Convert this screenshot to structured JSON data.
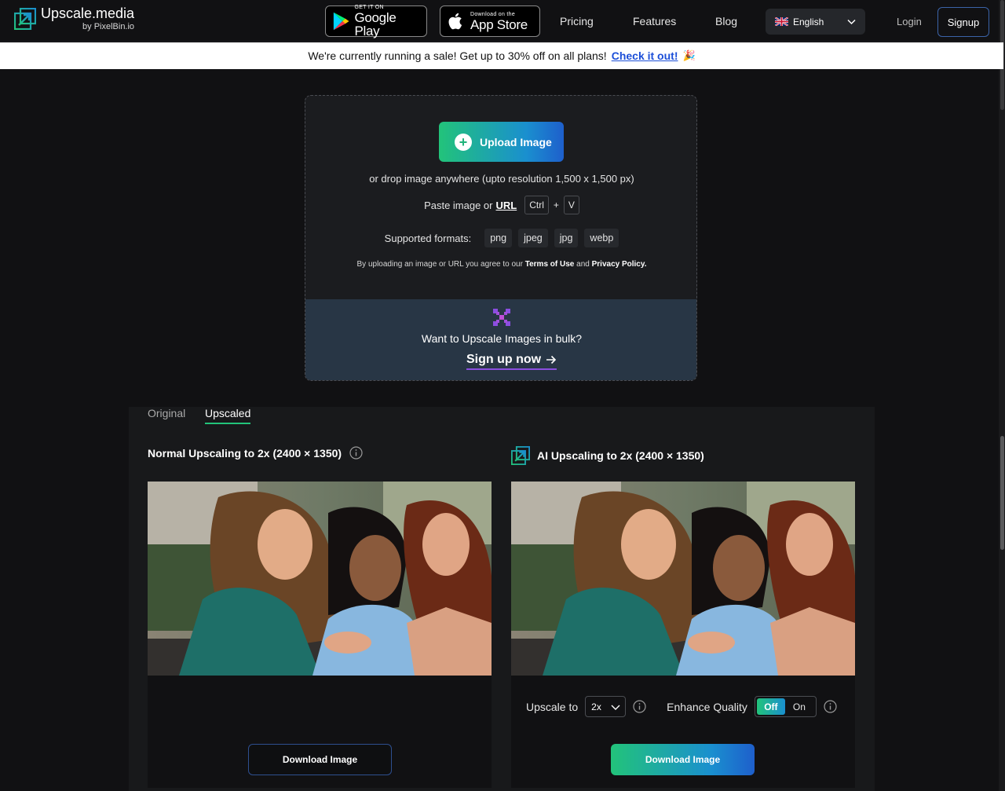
{
  "header": {
    "logo_name": "Upscale.media",
    "logo_by": "by PixelBin.io",
    "google_play": {
      "small": "GET IT ON",
      "big": "Google Play"
    },
    "app_store": {
      "small": "Download on the",
      "big": "App Store"
    },
    "nav": {
      "pricing": "Pricing",
      "features": "Features",
      "blog": "Blog"
    },
    "language": "English",
    "login": "Login",
    "signup": "Signup"
  },
  "banner": {
    "text": "We're currently running a sale! Get up to 30% off on all plans!",
    "link": "Check it out!",
    "emoji": "🎉"
  },
  "upload": {
    "button": "Upload Image",
    "drop_text": "or drop image anywhere (upto resolution 1,500 x 1,500 px)",
    "paste_label": "Paste image or",
    "url_label": "URL",
    "key_ctrl": "Ctrl",
    "key_plus": "+",
    "key_v": "V",
    "formats_label": "Supported formats:",
    "formats": [
      "png",
      "jpeg",
      "jpg",
      "webp"
    ],
    "terms_prefix": "By uploading an image or URL you agree to our",
    "terms_link": "Terms of Use",
    "terms_and": "and",
    "privacy_link": "Privacy Policy."
  },
  "bulk": {
    "text": "Want to Upscale Images in bulk?",
    "link": "Sign up now"
  },
  "compare": {
    "tabs": {
      "original": "Original",
      "upscaled": "Upscaled"
    },
    "active_tab": "Upscaled",
    "left_title": "Normal Upscaling to 2x (2400 × 1350)",
    "right_title": "AI Upscaling to 2x (2400 × 1350)",
    "left_download": "Download Image",
    "right_download": "Download Image",
    "upscale_label": "Upscale to",
    "upscale_value": "2x",
    "enhance_label": "Enhance Quality",
    "toggle_off": "Off",
    "toggle_on": "On",
    "toggle_state": "Off"
  },
  "colors": {
    "accent_green": "#22c37a",
    "accent_blue": "#1e5fcc",
    "bulk_bg": "#283645",
    "bulk_accent": "#8b4ee0"
  }
}
